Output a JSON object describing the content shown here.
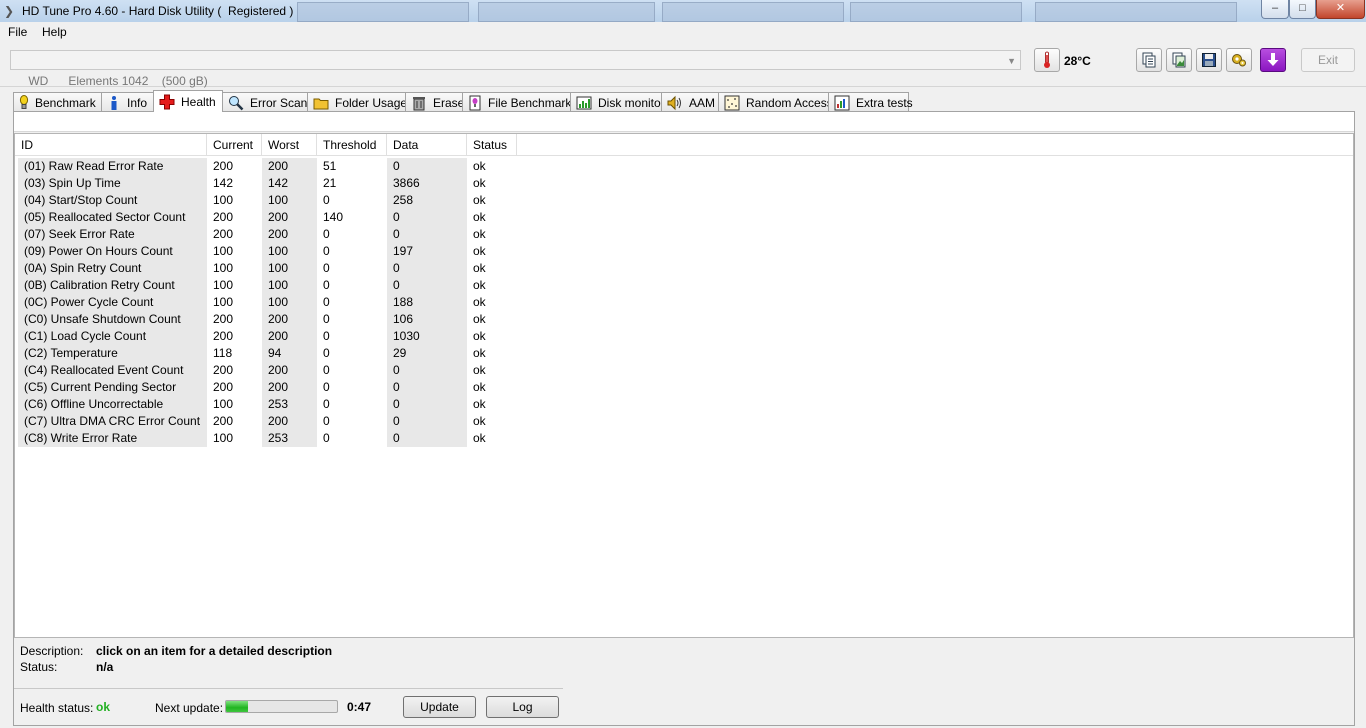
{
  "window": {
    "title": "HD Tune Pro 4.60 - Hard Disk Utility (  Registered )",
    "controls": {
      "minimize": "–",
      "maximize": "□",
      "close": "✕"
    }
  },
  "menu": {
    "file": "File",
    "help": "Help"
  },
  "toolbar": {
    "drive": "WD      Elements 1042    (500 gB)",
    "temperature": "28",
    "temperature_unit": "°C",
    "exit_label": "Exit",
    "icons": [
      "thermometer-icon",
      "copy-text-icon",
      "copy-screenshot-icon",
      "save-icon",
      "options-icon",
      "download-icon"
    ]
  },
  "tabs": [
    {
      "label": "Benchmark",
      "icon": "benchmark-icon"
    },
    {
      "label": "Info",
      "icon": "info-icon"
    },
    {
      "label": "Health",
      "icon": "health-icon",
      "active": true
    },
    {
      "label": "Error Scan",
      "icon": "error-scan-icon"
    },
    {
      "label": "Folder Usage",
      "icon": "folder-icon"
    },
    {
      "label": "Erase",
      "icon": "erase-icon"
    },
    {
      "label": "File Benchmark",
      "icon": "file-benchmark-icon"
    },
    {
      "label": "Disk monitor",
      "icon": "disk-monitor-icon"
    },
    {
      "label": "AAM",
      "icon": "speaker-icon"
    },
    {
      "label": "Random Access",
      "icon": "random-access-icon"
    },
    {
      "label": "Extra tests",
      "icon": "extra-tests-icon"
    }
  ],
  "table": {
    "columns": [
      "ID",
      "Current",
      "Worst",
      "Threshold",
      "Data",
      "Status"
    ],
    "rows": [
      [
        "(01) Raw Read Error Rate",
        "200",
        "200",
        "51",
        "0",
        "ok"
      ],
      [
        "(03) Spin Up Time",
        "142",
        "142",
        "21",
        "3866",
        "ok"
      ],
      [
        "(04) Start/Stop Count",
        "100",
        "100",
        "0",
        "258",
        "ok"
      ],
      [
        "(05) Reallocated Sector Count",
        "200",
        "200",
        "140",
        "0",
        "ok"
      ],
      [
        "(07) Seek Error Rate",
        "200",
        "200",
        "0",
        "0",
        "ok"
      ],
      [
        "(09) Power On Hours Count",
        "100",
        "100",
        "0",
        "197",
        "ok"
      ],
      [
        "(0A) Spin Retry Count",
        "100",
        "100",
        "0",
        "0",
        "ok"
      ],
      [
        "(0B) Calibration Retry Count",
        "100",
        "100",
        "0",
        "0",
        "ok"
      ],
      [
        "(0C) Power Cycle Count",
        "100",
        "100",
        "0",
        "188",
        "ok"
      ],
      [
        "(C0) Unsafe Shutdown Count",
        "200",
        "200",
        "0",
        "106",
        "ok"
      ],
      [
        "(C1) Load Cycle Count",
        "200",
        "200",
        "0",
        "1030",
        "ok"
      ],
      [
        "(C2) Temperature",
        "118",
        "94",
        "0",
        "29",
        "ok"
      ],
      [
        "(C4) Reallocated Event Count",
        "200",
        "200",
        "0",
        "0",
        "ok"
      ],
      [
        "(C5) Current Pending Sector",
        "200",
        "200",
        "0",
        "0",
        "ok"
      ],
      [
        "(C6) Offline Uncorrectable",
        "100",
        "253",
        "0",
        "0",
        "ok"
      ],
      [
        "(C7) Ultra DMA CRC Error Count",
        "200",
        "200",
        "0",
        "0",
        "ok"
      ],
      [
        "(C8) Write Error Rate",
        "100",
        "253",
        "0",
        "0",
        "ok"
      ]
    ]
  },
  "details": {
    "description_label": "Description:",
    "description_value": "click on an item for a detailed description",
    "status_label": "Status:",
    "status_value": "n/a"
  },
  "footer": {
    "health_label": "Health status:",
    "health_value": "ok",
    "next_update_label": "Next update:",
    "progress_fraction": 0.2,
    "countdown": "0:47",
    "update_label": "Update",
    "log_label": "Log"
  },
  "colors": {
    "health_ok": "#22b022",
    "progress": "#21b521",
    "download_button": "#9b1fc9",
    "thermometer": "#d92323"
  }
}
